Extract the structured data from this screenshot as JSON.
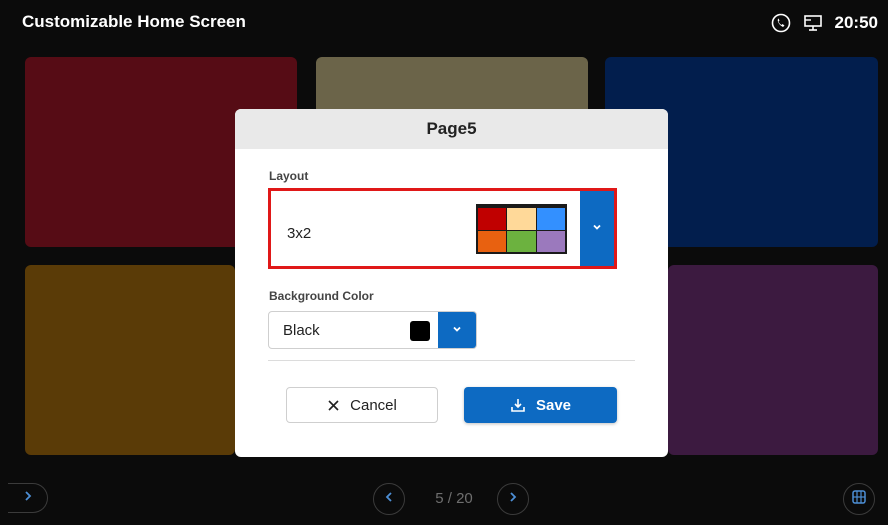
{
  "app": {
    "title": "Customizable Home Screen"
  },
  "status_bar": {
    "time": "20:50",
    "icons": [
      "phone-icon",
      "monitor-icon"
    ]
  },
  "tiles": [
    {
      "color": "#560c15"
    },
    {
      "color": "#6b6449"
    },
    {
      "color": "#021e4d"
    },
    {
      "color": "#5a3b07"
    },
    {
      "color": "#3c1a40"
    }
  ],
  "dialog": {
    "title": "Page5",
    "layout": {
      "label": "Layout",
      "value": "3x2",
      "preview_colors": [
        "#c00000",
        "#ffd999",
        "#3390ff",
        "#e86110",
        "#6cb23f",
        "#9b79bd"
      ]
    },
    "background_color": {
      "label": "Background Color",
      "value": "Black",
      "swatch": "#000000"
    },
    "cancel_label": "Cancel",
    "save_label": "Save"
  },
  "pager": {
    "text": "5 / 20"
  },
  "colors": {
    "accent": "#0d6ac2",
    "highlight_border": "#e01818"
  }
}
